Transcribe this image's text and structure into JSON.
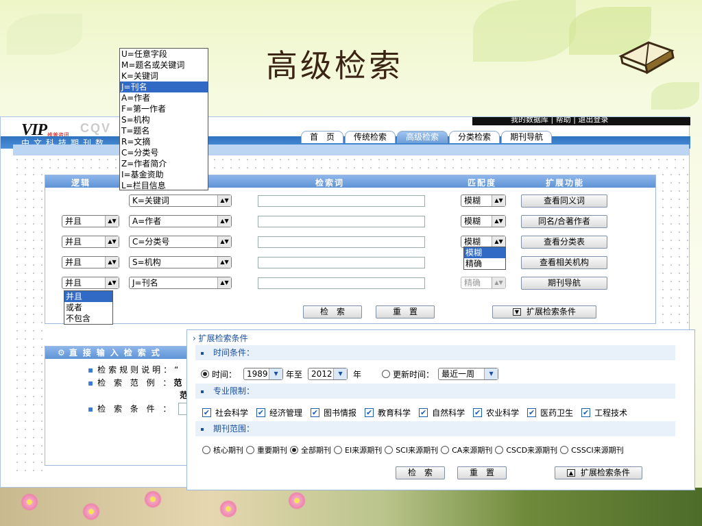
{
  "slide_title": "高级检索",
  "site": {
    "logo_text": "VIP",
    "logo_sub": "维普资讯",
    "cqvip_text": "CQV",
    "banner_text": "中文科技期刊数",
    "topright_text": "我的数据库 | 帮助 | 退出登录",
    "nav_tabs": [
      "首　页",
      "传统检索",
      "高级检索",
      "分类检索",
      "期刊导航"
    ],
    "active_tab": "高级检索"
  },
  "field_dropdown": {
    "items": [
      "U=任意字段",
      "M=题名或关键词",
      "K=关键词",
      "J=刊名",
      "A=作者",
      "F=第一作者",
      "S=机构",
      "T=题名",
      "R=文摘",
      "C=分类号",
      "Z=作者简介",
      "I=基金资助",
      "L=栏目信息"
    ],
    "selected": "J=刊名"
  },
  "form": {
    "headers": {
      "logic": "逻辑",
      "term": "检索词",
      "match": "匹配度",
      "ext": "扩展功能"
    },
    "rows": [
      {
        "logic": "",
        "field": "K=关键词",
        "term": "",
        "match": "模糊",
        "ext": "查看同义词"
      },
      {
        "logic": "并且",
        "field": "A=作者",
        "term": "",
        "match": "模糊",
        "ext": "同名/合著作者"
      },
      {
        "logic": "并且",
        "field": "C=分类号",
        "term": "",
        "match": "模糊",
        "ext": "查看分类表"
      },
      {
        "logic": "并且",
        "field": "S=机构",
        "term": "",
        "match": "",
        "ext": "查看相关机构"
      },
      {
        "logic": "并且",
        "field": "J=刊名",
        "term": "",
        "match": "精确",
        "ext": "期刊导航"
      }
    ],
    "match_dropdown": {
      "items": [
        "模糊",
        "精确"
      ],
      "selected": "模糊"
    },
    "logic_dropdown": {
      "items": [
        "并且",
        "或者",
        "不包含"
      ],
      "selected": "并且"
    },
    "search_btn": "检　索",
    "reset_btn": "重　置",
    "expand_btn": "扩展检索条件"
  },
  "direct": {
    "header": "直接输入检索式",
    "rule_label": "检索规则说明：",
    "rule_tail": "“",
    "example_label": "检 索 范 例 ：",
    "example_tail": "范",
    "example_tail2": "范",
    "cond_label": "检 索 条 件 ："
  },
  "expand": {
    "title": "扩展检索条件",
    "time_section": "时间条件：",
    "time_label": "时间：",
    "from_year": "1989",
    "to_label": "年至",
    "to_year": "2012",
    "year_label": "年",
    "update_label": "更新时间：",
    "update_value": "最近一周",
    "subject_section": "专业限制：",
    "subjects": [
      "社会科学",
      "经济管理",
      "图书情报",
      "教育科学",
      "自然科学",
      "农业科学",
      "医药卫生",
      "工程技术"
    ],
    "journal_section": "期刊范围：",
    "journals": [
      "核心期刊",
      "重要期刊",
      "全部期刊",
      "EI来源期刊",
      "SCI来源期刊",
      "CA来源期刊",
      "CSCD来源期刊",
      "CSSCI来源期刊"
    ],
    "journal_selected": "全部期刊",
    "search_btn": "检　索",
    "reset_btn": "重　置",
    "expand_btn": "扩展检索条件"
  }
}
